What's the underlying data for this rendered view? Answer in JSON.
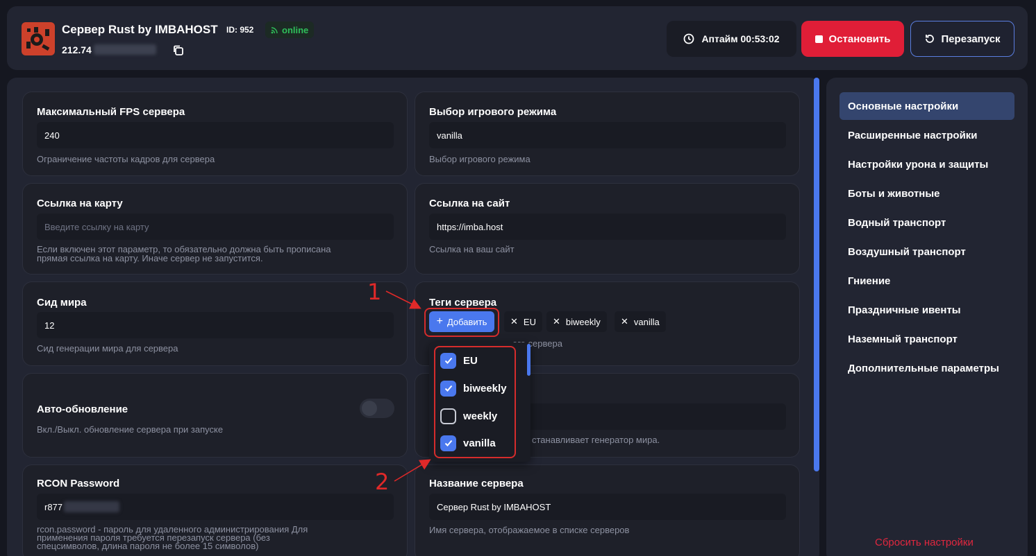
{
  "header": {
    "title": "Сервер Rust by IMBAHOST",
    "id_label": "ID: 952",
    "status": "online",
    "ip_visible": "212.74",
    "uptime_label": "Аптайм 00:53:02",
    "stop_label": "Остановить",
    "restart_label": "Перезапуск",
    "colors": {
      "stop": "#e01e37",
      "accent": "#4a78ee",
      "online": "#2fbf5a"
    }
  },
  "settings": {
    "max_fps": {
      "title": "Максимальный FPS сервера",
      "value": "240",
      "desc": "Ограничение частоты кадров для сервера"
    },
    "game_mode": {
      "title": "Выбор игрового режима",
      "value": "vanilla",
      "desc": "Выбор игрового режима"
    },
    "map_url": {
      "title": "Ссылка на карту",
      "placeholder": "Введите ссылку на карту",
      "desc_line1": "Если включен этот параметр, то обязательно должна быть прописана",
      "desc_line2": "прямая ссылка на карту. Иначе сервер не запустится."
    },
    "site_url": {
      "title": "Ссылка на сайт",
      "value": "https://imba.host",
      "desc": "Ссылка на ваш сайт"
    },
    "world_seed": {
      "title": "Сид мира",
      "value": "12",
      "desc": "Сид генерации мира для сервера"
    },
    "tags": {
      "title": "Теги сервера",
      "add_label": "Добавить",
      "chips": [
        "EU",
        "biweekly",
        "vanilla"
      ],
      "desc_partial": "его сервера"
    },
    "auto_update": {
      "title": "Авто-обновление",
      "desc": "Вкл./Выкл. обновление сервера при запуске",
      "enabled": false
    },
    "hidden_card": {
      "desc_partial": "станавливает генератор мира."
    },
    "rcon": {
      "title": "RCON Password",
      "value_visible": "r877",
      "desc_line1": "rcon.password - пароль для удаленного администрирования Для",
      "desc_line2": "применения пароля требуется перезапуск сервера (без",
      "desc_line3": "спецсимволов, длина пароля не более 15 символов)"
    },
    "server_name": {
      "title": "Название сервера",
      "value": "Сервер Rust by IMBAHOST",
      "desc": "Имя сервера, отображаемое в списке серверов"
    }
  },
  "tag_dropdown": {
    "options": [
      {
        "label": "EU",
        "checked": true
      },
      {
        "label": "biweekly",
        "checked": true
      },
      {
        "label": "weekly",
        "checked": false
      },
      {
        "label": "vanilla",
        "checked": true
      }
    ]
  },
  "annotations": {
    "one": "1",
    "two": "2"
  },
  "sidebar": {
    "items": [
      {
        "label": "Основные настройки",
        "active": true
      },
      {
        "label": "Расширенные настройки"
      },
      {
        "label": "Настройки урона и защиты"
      },
      {
        "label": "Боты и животные"
      },
      {
        "label": "Водный транспорт"
      },
      {
        "label": "Воздушный транспорт"
      },
      {
        "label": "Гниение"
      },
      {
        "label": "Праздничные ивенты"
      },
      {
        "label": "Наземный транспорт"
      },
      {
        "label": "Дополнительные параметры"
      }
    ],
    "reset_label": "Сбросить настройки"
  }
}
